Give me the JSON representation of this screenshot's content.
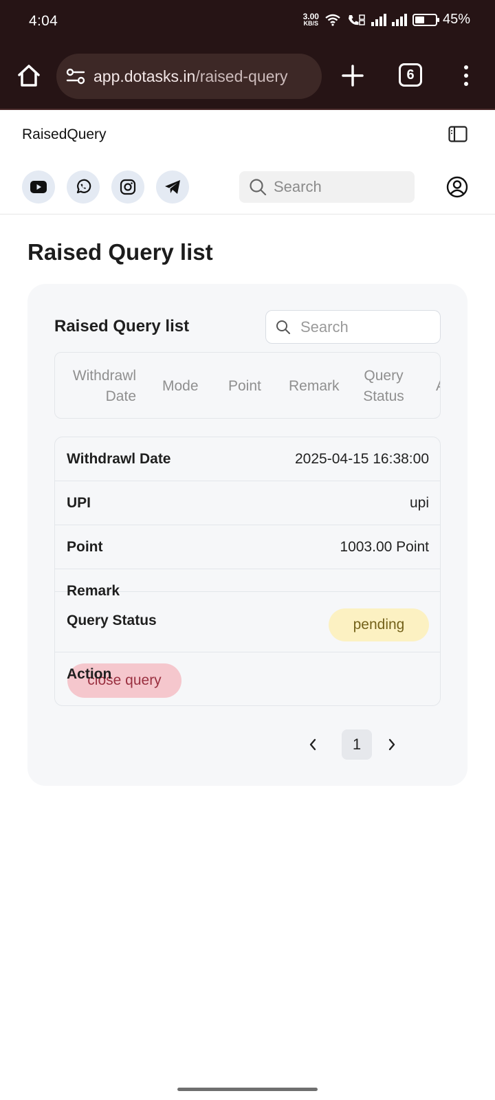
{
  "status_bar": {
    "time": "4:04",
    "net_speed_value": "3.00",
    "net_speed_unit": "KB/S",
    "battery_percent": "45%",
    "battery_level": 0.45
  },
  "browser": {
    "url_domain": "app.dotasks.in",
    "url_path": "/raised-query",
    "tab_count": "6"
  },
  "header": {
    "app_title": "RaisedQuery",
    "search_placeholder": "Search",
    "social_icons": [
      "youtube-icon",
      "whatsapp-icon",
      "instagram-icon",
      "telegram-icon"
    ]
  },
  "main": {
    "page_title": "Raised Query list",
    "card": {
      "title": "Raised Query list",
      "search_placeholder": "Search",
      "columns": [
        "Withdrawl Date",
        "Mode",
        "Point",
        "Remark",
        "Query Status",
        "A"
      ],
      "detail": {
        "withdrawl_date_label": "Withdrawl Date",
        "withdrawl_date_value": "2025-04-15 16:38:00",
        "mode_label": "UPI",
        "mode_value": "upi",
        "point_label": "Point",
        "point_value": "1003.00 Point",
        "remark_label": "Remark",
        "query_status_label": "Query Status",
        "query_status_value": "pending",
        "action_label": "Action",
        "action_button": "close query"
      },
      "pagination": {
        "current_page": "1"
      }
    }
  },
  "colors": {
    "chrome_bg": "#261415",
    "url_bar_bg": "#3d2826",
    "card_bg": "#f6f7f9",
    "pending_badge_bg": "#fcf1c2",
    "close_button_bg": "#f4bec6"
  }
}
